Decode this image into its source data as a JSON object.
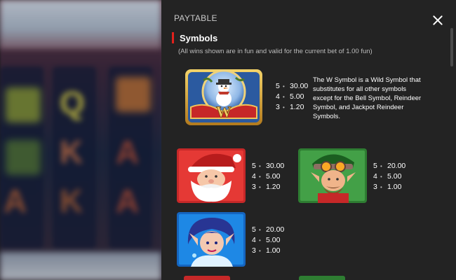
{
  "paytable": {
    "title": "PAYTABLE",
    "close_icon": "close-icon"
  },
  "section": {
    "title": "Symbols",
    "note": "(All wins shown are in fun and valid for the current bet of 1.00 fun)"
  },
  "wild": {
    "icon": "snowman-wild-icon",
    "pays": [
      {
        "count": "5",
        "value": "30.00"
      },
      {
        "count": "4",
        "value": "5.00"
      },
      {
        "count": "3",
        "value": "1.20"
      }
    ],
    "description": "The W Symbol is a Wild Symbol that substitutes for all other symbols except for the Bell Symbol, Reindeer Symbol, and Jackpot Reindeer Symbols."
  },
  "santa": {
    "icon": "santa-icon",
    "pays": [
      {
        "count": "5",
        "value": "30.00"
      },
      {
        "count": "4",
        "value": "5.00"
      },
      {
        "count": "3",
        "value": "1.20"
      }
    ]
  },
  "elf": {
    "icon": "elf-icon",
    "pays": [
      {
        "count": "5",
        "value": "20.00"
      },
      {
        "count": "4",
        "value": "5.00"
      },
      {
        "count": "3",
        "value": "1.00"
      }
    ]
  },
  "fairy": {
    "icon": "ice-fairy-icon",
    "pays": [
      {
        "count": "5",
        "value": "20.00"
      },
      {
        "count": "4",
        "value": "5.00"
      },
      {
        "count": "3",
        "value": "1.00"
      }
    ]
  },
  "colors": {
    "panel": "#232323",
    "accent": "#e2211c",
    "text": "#ffffff"
  }
}
